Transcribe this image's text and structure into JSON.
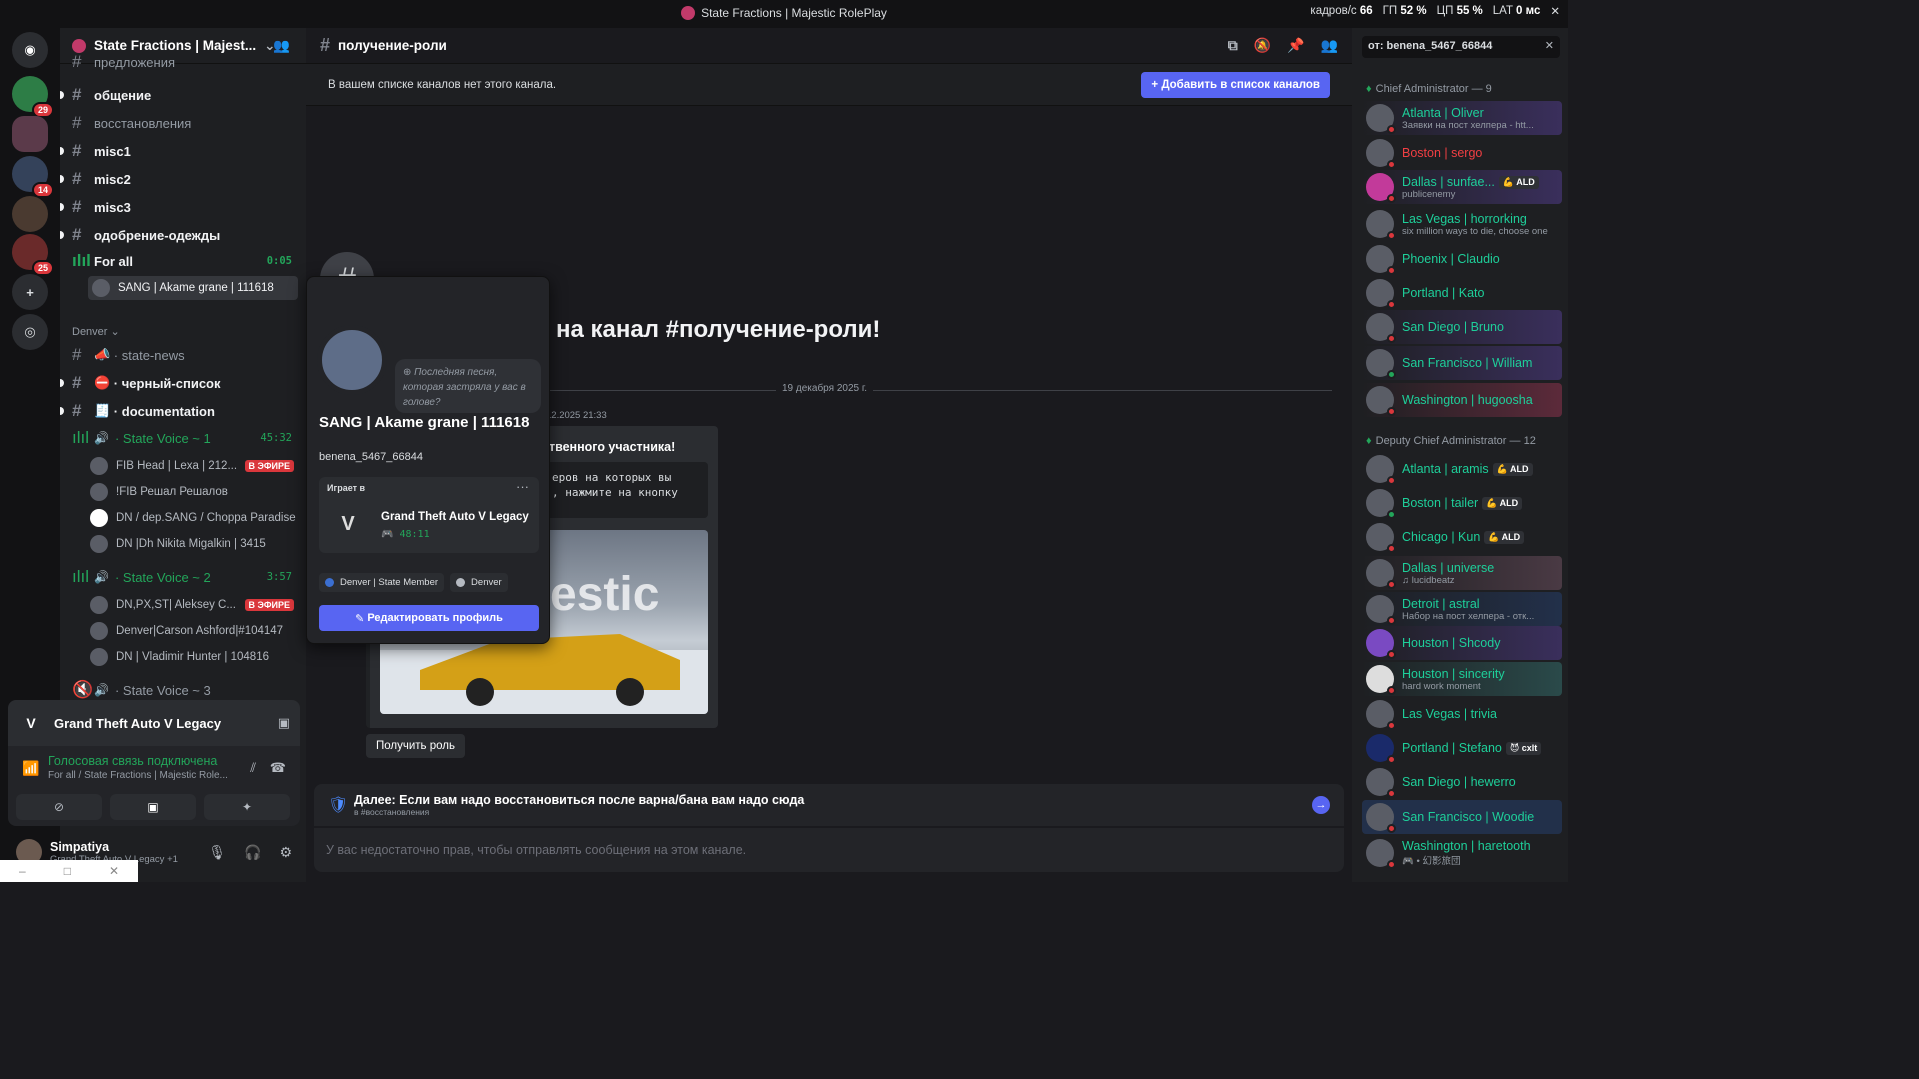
{
  "window": {
    "title": "State Fractions | Majestic RolePlay",
    "stats": {
      "fps_label": "кадров/с",
      "fps": "66",
      "gpu_label": "ГП",
      "gpu": "52 %",
      "cpu_label": "ЦП",
      "cpu": "55 %",
      "lat_label": "LAT",
      "lat": "0 мс"
    }
  },
  "servers": [
    {
      "badge": "29",
      "color": "#2d7d46"
    },
    {
      "badge": "",
      "color": "#5b3a4a"
    },
    {
      "badge": "14",
      "color": "#34425a"
    },
    {
      "badge": "",
      "color": "#4a3a30"
    },
    {
      "badge": "25",
      "color": "#6a2a2a"
    }
  ],
  "sidebar": {
    "server_name": "State Fractions | Majest...",
    "channels_top": [
      {
        "name": "предложения",
        "unread": false
      },
      {
        "name": "общение",
        "unread": true
      },
      {
        "name": "восстановления",
        "unread": false
      },
      {
        "name": "misc1",
        "unread": true
      },
      {
        "name": "misc2",
        "unread": true
      },
      {
        "name": "misc3",
        "unread": true
      },
      {
        "name": "одобрение-одежды",
        "unread": true
      }
    ],
    "voice_forall": {
      "name": "For all",
      "time": "0:05",
      "user": "SANG | Akame grane | 111618"
    },
    "category": "Denver",
    "channels_denver": [
      {
        "name": "state-news",
        "emoji": "📣",
        "unread": false
      },
      {
        "name": "черный-список",
        "emoji": "⛔",
        "unread": true
      },
      {
        "name": "documentation",
        "emoji": "🧾",
        "unread": true
      }
    ],
    "voice1": {
      "name": "State Voice ~ 1",
      "time": "45:32",
      "users": [
        "FIB Head | Lexa | 212...",
        "!FIB Решал Решалов",
        "DN / dep.SANG / Choppa Paradise",
        "DN |Dh Nikita Migalkin | 3415"
      ],
      "live": "В ЭФИРЕ"
    },
    "voice2": {
      "name": "State Voice ~ 2",
      "time": "3:57",
      "users": [
        "DN,PX,ST| Aleksey C...",
        "Denver|Carson Ashford|#104147",
        "DN | Vladimir Hunter | 104816"
      ],
      "live": "В ЭФИРЕ"
    },
    "voice3": {
      "name": "State Voice ~ 3"
    }
  },
  "activity": {
    "game": "Grand Theft Auto V Legacy"
  },
  "voice_conn": {
    "status": "Голосовая связь подключена",
    "sub": "For all / State Fractions | Majestic Role..."
  },
  "user": {
    "name": "Simpatiya",
    "sub": "Grand Theft Auto V Legacy +1"
  },
  "channel": {
    "name": "получение-роли",
    "notice": "В вашем списке каналов нет этого канала.",
    "add_button": "+ Добавить в список каналов",
    "welcome": "на канал #получение-роли!",
    "date": "19 декабря 2025 г.",
    "msg_time": "12.2025 21:33",
    "embed_title": "ственного участника!",
    "embed_code_l1": "еров на которых вы",
    "embed_code_l2": ", нажмите на кнопку",
    "get_role": "Получить роль",
    "next_title": "Далее: Если вам надо восстановиться после варна/бана вам надо сюда",
    "next_sub": "в #восстановления",
    "input_placeholder": "У вас недостаточно прав, чтобы отправлять сообщения на этом канале."
  },
  "popout": {
    "status_text": "Последняя песня, которая застряла у вас в голове?",
    "name": "SANG | Akame grane | 111618",
    "username": "benena_5467_66844",
    "playing_label": "Играет в",
    "game": "Grand Theft Auto V Legacy",
    "game_time": "48:11",
    "roles": [
      "Denver | State Member",
      "Denver"
    ],
    "edit": "Редактировать профиль"
  },
  "members": {
    "search": "от: benena_5467_66844",
    "group1": "Chief Administrator — 9",
    "chiefs": [
      {
        "name": "Atlanta | Oliver",
        "sub": "Заявки на пост хелпера - htt...",
        "tag": "",
        "red": false
      },
      {
        "name": "Boston | sergo",
        "sub": "",
        "tag": "",
        "red": true
      },
      {
        "name": "Dallas | sunfae...",
        "sub": "publicenemy",
        "tag": "ALD",
        "red": false
      },
      {
        "name": "Las Vegas | horrorking",
        "sub": "six million ways to die, choose one",
        "tag": "",
        "red": false
      },
      {
        "name": "Phoenix | Claudio",
        "sub": "",
        "tag": "",
        "red": false
      },
      {
        "name": "Portland | Kato",
        "sub": "",
        "tag": "",
        "red": false
      },
      {
        "name": "San Diego | Bruno",
        "sub": "",
        "tag": "",
        "red": false
      },
      {
        "name": "San Francisco | William",
        "sub": "",
        "tag": "",
        "red": false
      },
      {
        "name": "Washington | hugoosha",
        "sub": "",
        "tag": "",
        "red": false
      }
    ],
    "group2": "Deputy Chief Administrator — 12",
    "deputies": [
      {
        "name": "Atlanta | aramis",
        "sub": "",
        "tag": "ALD"
      },
      {
        "name": "Boston | tailer",
        "sub": "",
        "tag": "ALD"
      },
      {
        "name": "Chicago | Kun",
        "sub": "",
        "tag": "ALD"
      },
      {
        "name": "Dallas | universe",
        "sub": "♫ lucidbeatz",
        "tag": ""
      },
      {
        "name": "Detroit | astral",
        "sub": "Набор на пост хелпера - отк...",
        "tag": ""
      },
      {
        "name": "Houston | Shcody",
        "sub": "",
        "tag": ""
      },
      {
        "name": "Houston | sincerity",
        "sub": "hard work moment",
        "tag": ""
      },
      {
        "name": "Las Vegas | trivia",
        "sub": "",
        "tag": ""
      },
      {
        "name": "Portland | Stefano",
        "sub": "",
        "tag": "cxlt"
      },
      {
        "name": "San Diego | hewerro",
        "sub": "",
        "tag": ""
      },
      {
        "name": "San Francisco | Woodie",
        "sub": "",
        "tag": ""
      },
      {
        "name": "Washington | haretooth",
        "sub": "幻影旅団",
        "tag": ""
      }
    ]
  }
}
